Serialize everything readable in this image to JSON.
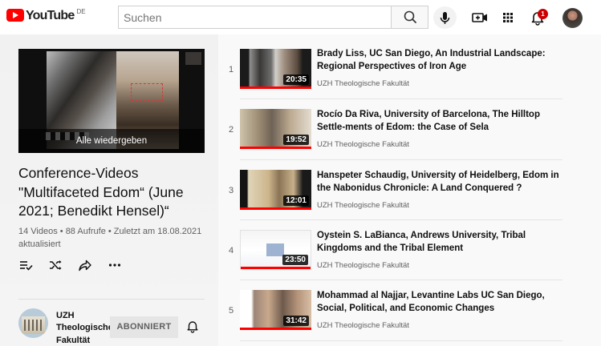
{
  "header": {
    "logo_text": "YouTube",
    "country_code": "DE",
    "search_placeholder": "Suchen",
    "notification_count": "1",
    "brand_color": "#ff0000"
  },
  "playlist": {
    "play_all_label": "Alle wiedergeben",
    "title": "Conference-Videos \"Multifaceted Edom“ (June 2021; Benedikt Hensel)“",
    "meta": "14 Videos • 88 Aufrufe • Zuletzt am 18.08.2021 aktualisiert",
    "actions": [
      "add-to-queue-icon",
      "shuffle-icon",
      "share-icon",
      "more-icon"
    ]
  },
  "channel": {
    "name": "UZH Theologische Fakultät",
    "subscribe_label": "ABONNIERT"
  },
  "videos": [
    {
      "index": "1",
      "title": "Brady Liss, UC San Diego, An Industrial Landscape: Regional Perspectives of Iron Age",
      "channel": "UZH Theologische Fakultät",
      "duration": "20:35"
    },
    {
      "index": "2",
      "title": "Rocío Da Riva, University of Barcelona, The Hilltop Settle-ments of Edom: the Case of Sela",
      "channel": "UZH Theologische Fakultät",
      "duration": "19:52"
    },
    {
      "index": "3",
      "title": "Hanspeter Schaudig, University of Heidelberg, Edom in the Nabonidus Chronicle: A Land Conquered ?",
      "channel": "UZH Theologische Fakultät",
      "duration": "12:01"
    },
    {
      "index": "4",
      "title": "Oystein S. LaBianca, Andrews University, Tribal Kingdoms and the Tribal Element",
      "channel": "UZH Theologische Fakultät",
      "duration": "23:50"
    },
    {
      "index": "5",
      "title": "Mohammad al Najjar, Levantine Labs UC San Diego, Social, Political, and Economic Changes",
      "channel": "UZH Theologische Fakultät",
      "duration": "31:42"
    }
  ]
}
